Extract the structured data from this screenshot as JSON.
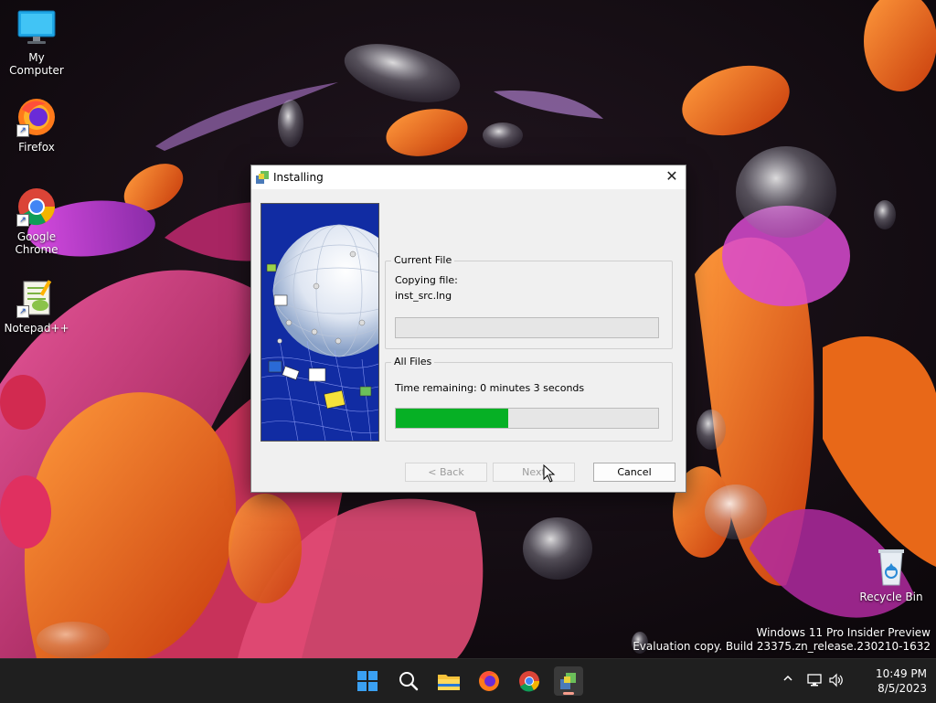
{
  "desktop": {
    "icons": [
      {
        "label": "My Computer",
        "icon": "monitor-icon"
      },
      {
        "label": "Firefox",
        "icon": "firefox-icon"
      },
      {
        "label": "Google Chrome",
        "icon": "chrome-icon"
      },
      {
        "label": "Notepad++",
        "icon": "notepadpp-icon"
      },
      {
        "label": "Recycle Bin",
        "icon": "recycle-bin-icon"
      }
    ],
    "watermark": {
      "line1": "Windows 11 Pro Insider Preview",
      "line2": "Evaluation copy. Build 23375.zn_release.230210-1632"
    }
  },
  "dialog": {
    "title": "Installing",
    "current_file": {
      "group_title": "Current File",
      "action": "Copying file:",
      "filename": "inst_src.lng",
      "progress": 0
    },
    "all_files": {
      "group_title": "All Files",
      "time_remaining": "Time remaining: 0 minutes 3 seconds",
      "progress": 0.43
    },
    "buttons": {
      "back": "< Back",
      "next": "Next",
      "cancel": "Cancel"
    }
  },
  "taskbar": {
    "icons": [
      "windows-start-icon",
      "search-icon",
      "file-explorer-icon",
      "firefox-icon",
      "chrome-icon",
      "installer-icon"
    ],
    "active": "installer-icon",
    "tray": {
      "time": "10:49 PM",
      "date": "8/5/2023"
    }
  },
  "colors": {
    "progress_fill": "#06b025",
    "taskbar_bg": "#1f1f1f",
    "dialog_bg": "#f0f0f0"
  }
}
